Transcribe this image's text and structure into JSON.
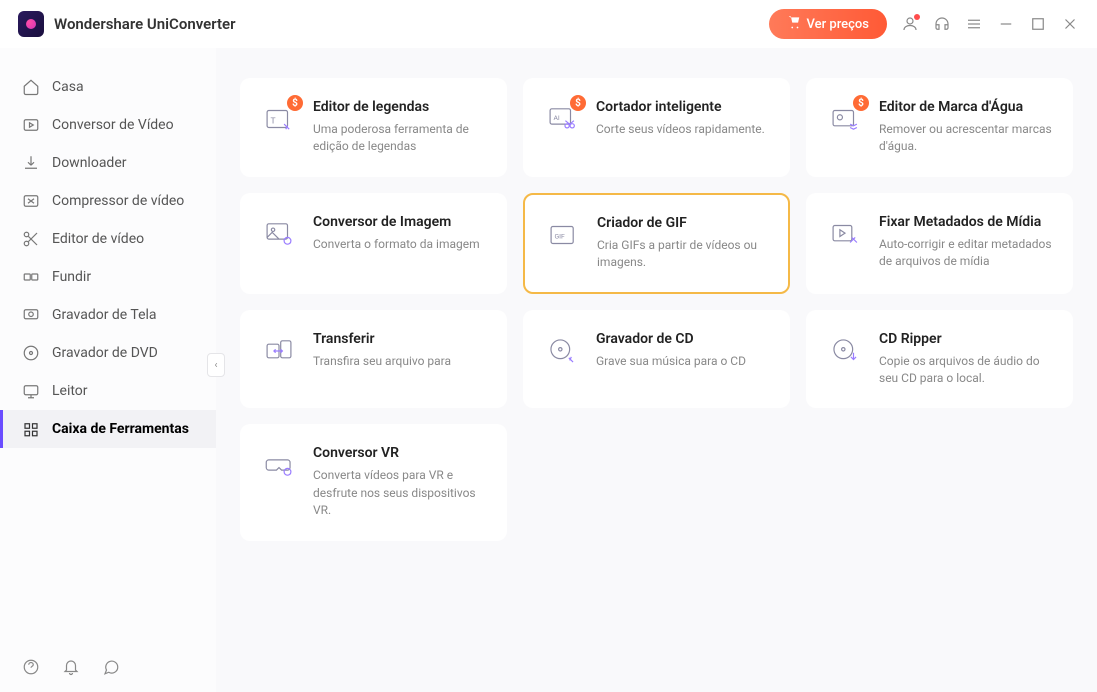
{
  "app": {
    "title": "Wondershare UniConverter"
  },
  "header": {
    "price_label": "Ver preços",
    "badge_symbol": "$"
  },
  "sidebar": {
    "items": [
      {
        "label": "Casa"
      },
      {
        "label": "Conversor de Vídeo"
      },
      {
        "label": "Downloader"
      },
      {
        "label": "Compressor de vídeo"
      },
      {
        "label": "Editor de vídeo"
      },
      {
        "label": "Fundir"
      },
      {
        "label": "Gravador de Tela"
      },
      {
        "label": "Gravador de DVD"
      },
      {
        "label": "Leitor"
      },
      {
        "label": "Caixa de Ferramentas"
      }
    ]
  },
  "tools": [
    {
      "title": "Editor de legendas",
      "desc": "Uma poderosa ferramenta de edição de legendas",
      "badge": true
    },
    {
      "title": "Cortador inteligente",
      "desc": "Corte seus vídeos rapidamente.",
      "badge": true
    },
    {
      "title": "Editor de Marca d'Água",
      "desc": "Remover ou acrescentar marcas d'água.",
      "badge": true
    },
    {
      "title": "Conversor de Imagem",
      "desc": "Converta o formato da imagem",
      "badge": false
    },
    {
      "title": "Criador de GIF",
      "desc": "Cria GIFs a partir de vídeos ou imagens.",
      "badge": false
    },
    {
      "title": "Fixar Metadados de Mídia",
      "desc": "Auto-corrigir e editar metadados de arquivos de mídia",
      "badge": false
    },
    {
      "title": "Transferir",
      "desc": "Transfira seu arquivo para",
      "badge": false
    },
    {
      "title": "Gravador de CD",
      "desc": "Grave sua música para o CD",
      "badge": false
    },
    {
      "title": "CD Ripper",
      "desc": "Copie os arquivos de áudio do seu CD para o local.",
      "badge": false
    },
    {
      "title": "Conversor VR",
      "desc": "Converta vídeos para VR e desfrute nos seus dispositivos VR.",
      "badge": false
    }
  ]
}
